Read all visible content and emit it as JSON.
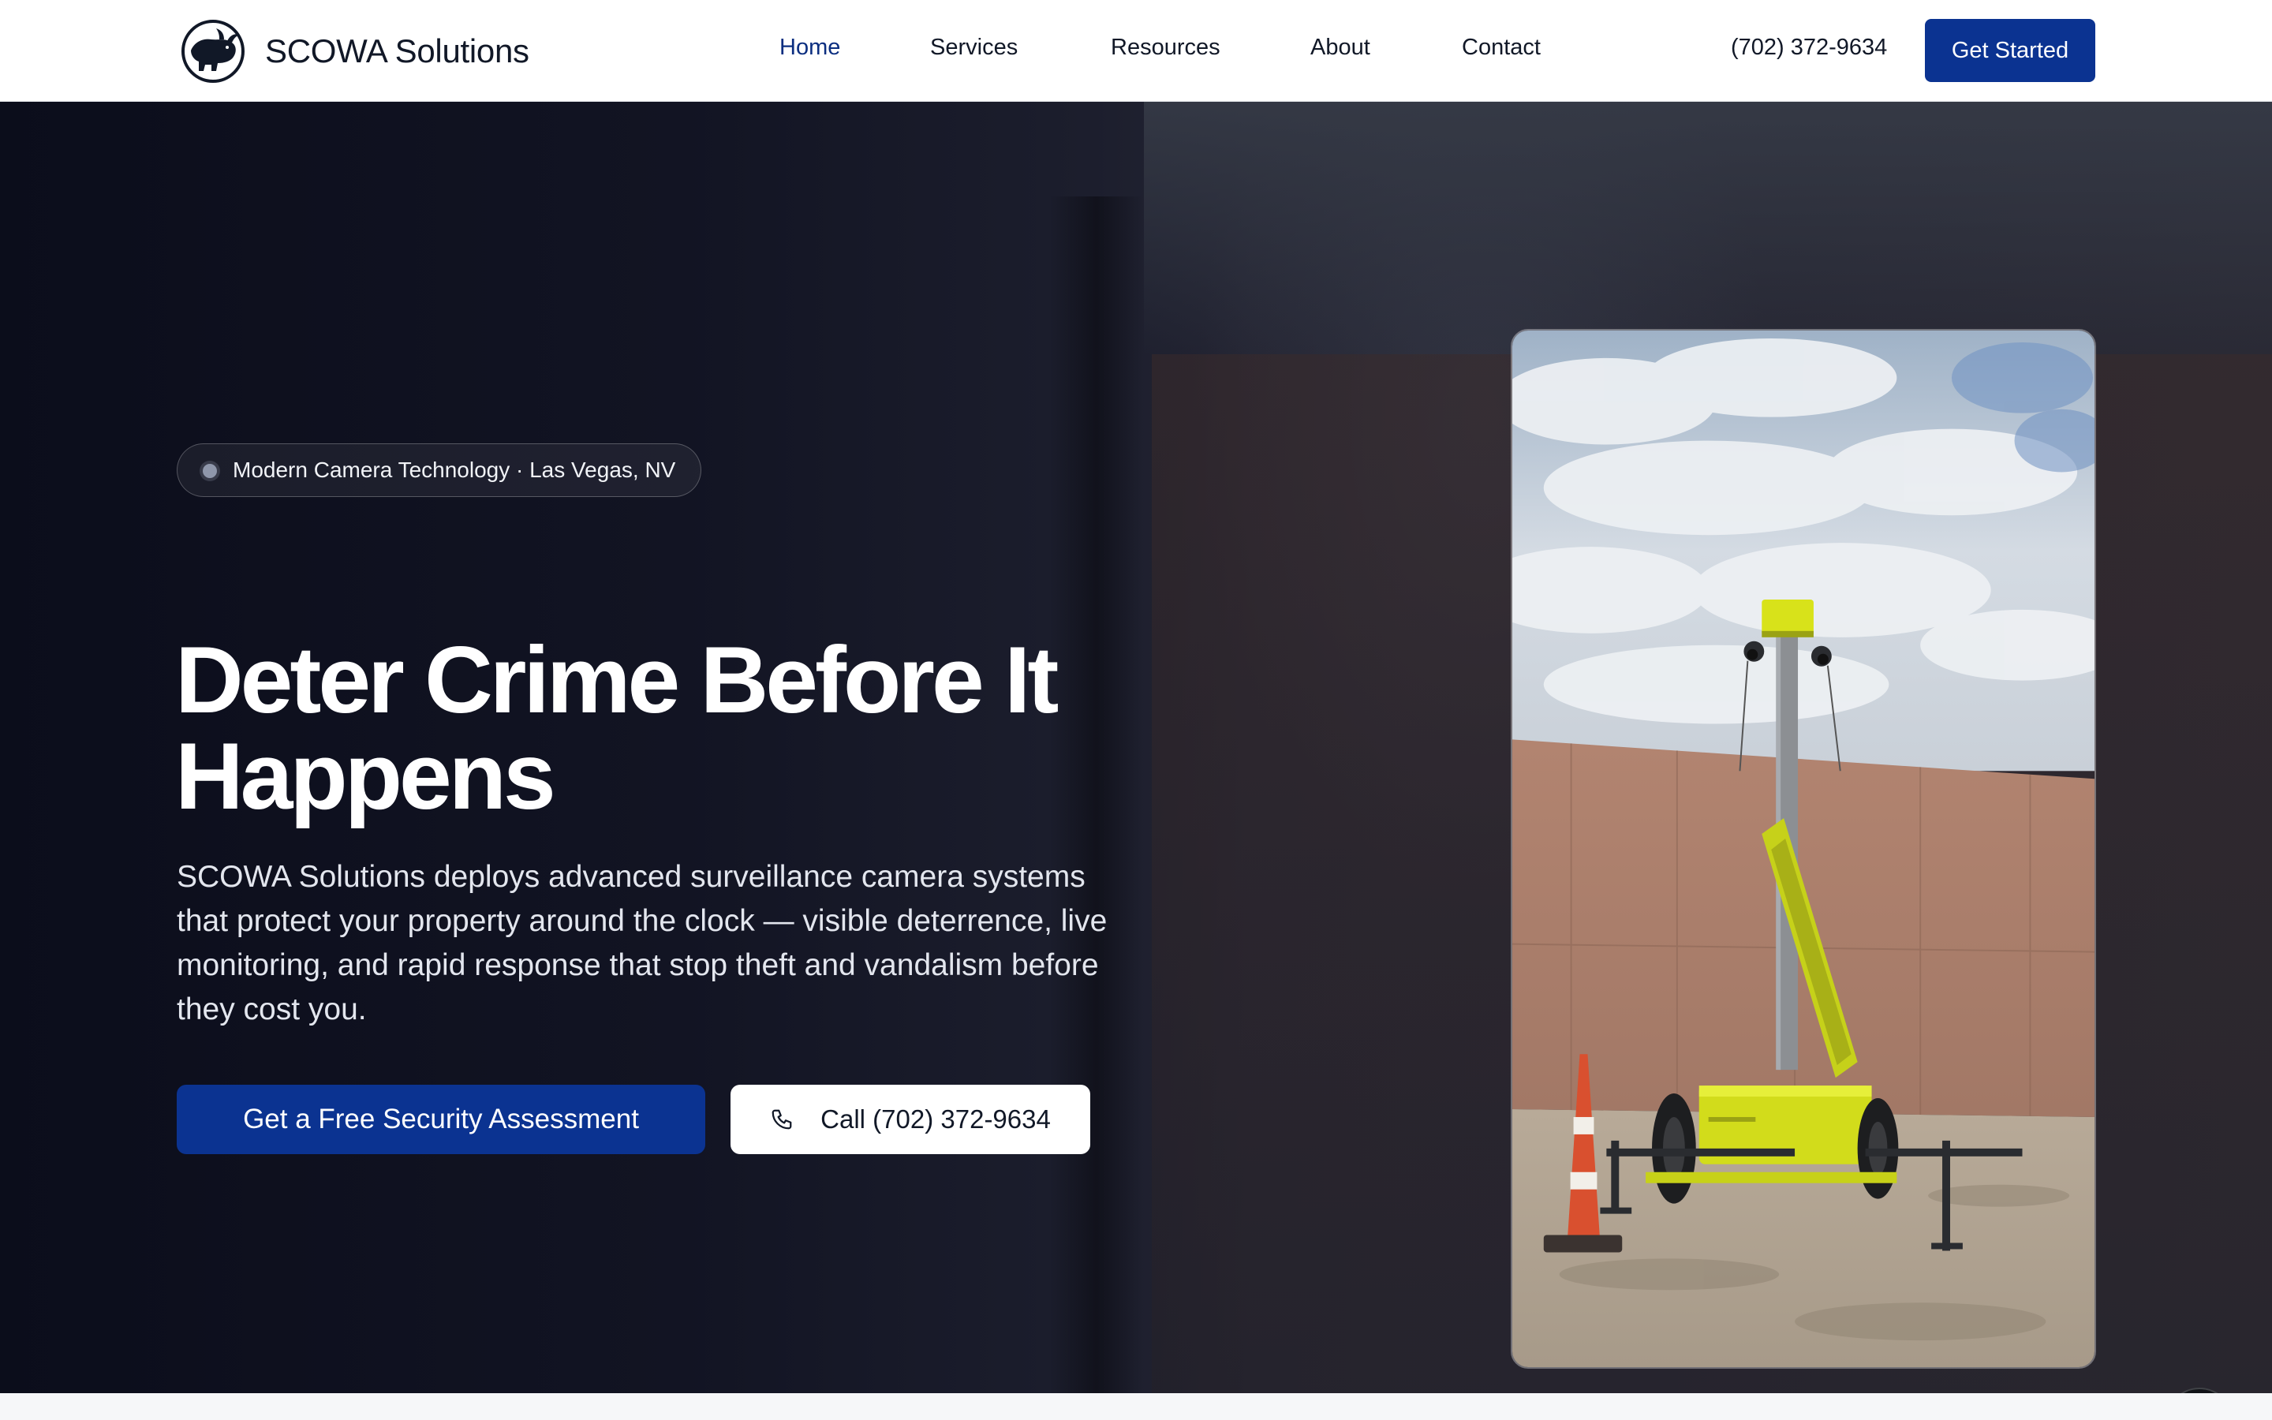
{
  "header": {
    "brand_name": "SCOWA Solutions",
    "logo_icon": "bull-logo-icon",
    "nav": [
      {
        "label": "Home",
        "active": true
      },
      {
        "label": "Services",
        "active": false
      },
      {
        "label": "Resources",
        "active": false
      },
      {
        "label": "About",
        "active": false
      },
      {
        "label": "Contact",
        "active": false
      }
    ],
    "phone": "(702) 372-9634",
    "cta_label": "Get Started"
  },
  "hero": {
    "badge": "Modern Camera Technology · Las Vegas, NV",
    "title": "Deter Crime Before It Happens",
    "description": "SCOWA Solutions deploys advanced surveillance camera systems that protect your property around the clock — visible deterrence, live monitoring, and rapid response that stop theft and vandalism before they cost you.",
    "primary_cta": "Get a Free Security Assessment",
    "secondary_cta": "Call (702) 372-9634",
    "secondary_icon": "phone-icon",
    "video_icon": "mute-icon"
  },
  "colors": {
    "accent": "#0b3391",
    "active_nav": "#0b2e80",
    "hero_dark": "#0b0d1b",
    "trailer_yellow": "#d8e21a"
  }
}
